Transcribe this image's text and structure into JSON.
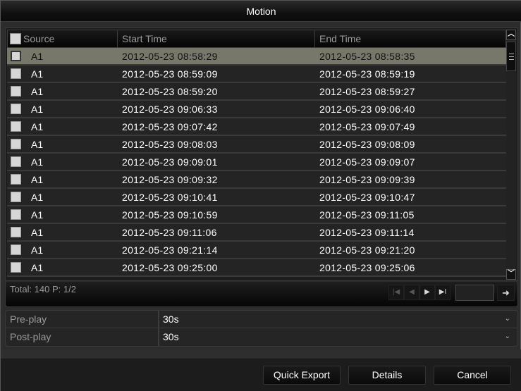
{
  "window": {
    "title": "Motion"
  },
  "table": {
    "columns": {
      "source": "Source",
      "start": "Start Time",
      "end": "End Time"
    },
    "rows": [
      {
        "source": "A1",
        "start": "2012-05-23 08:58:29",
        "end": "2012-05-23 08:58:35",
        "selected": true
      },
      {
        "source": "A1",
        "start": "2012-05-23 08:59:09",
        "end": "2012-05-23 08:59:19"
      },
      {
        "source": "A1",
        "start": "2012-05-23 08:59:20",
        "end": "2012-05-23 08:59:27"
      },
      {
        "source": "A1",
        "start": "2012-05-23 09:06:33",
        "end": "2012-05-23 09:06:40"
      },
      {
        "source": "A1",
        "start": "2012-05-23 09:07:42",
        "end": "2012-05-23 09:07:49"
      },
      {
        "source": "A1",
        "start": "2012-05-23 09:08:03",
        "end": "2012-05-23 09:08:09"
      },
      {
        "source": "A1",
        "start": "2012-05-23 09:09:01",
        "end": "2012-05-23 09:09:07"
      },
      {
        "source": "A1",
        "start": "2012-05-23 09:09:32",
        "end": "2012-05-23 09:09:39"
      },
      {
        "source": "A1",
        "start": "2012-05-23 09:10:41",
        "end": "2012-05-23 09:10:47"
      },
      {
        "source": "A1",
        "start": "2012-05-23 09:10:59",
        "end": "2012-05-23 09:11:05"
      },
      {
        "source": "A1",
        "start": "2012-05-23 09:11:06",
        "end": "2012-05-23 09:11:14"
      },
      {
        "source": "A1",
        "start": "2012-05-23 09:21:14",
        "end": "2012-05-23 09:21:20"
      },
      {
        "source": "A1",
        "start": "2012-05-23 09:25:00",
        "end": "2012-05-23 09:25:06"
      }
    ],
    "scroll_up_icon": "chevron-up-icon",
    "scroll_down_icon": "chevron-down-icon"
  },
  "pager": {
    "total_text": "Total: 140  P: 1/2",
    "first_icon": "⏮",
    "prev_icon": "◀",
    "next_icon": "▶",
    "last_icon": "▶I",
    "page_input_value": "",
    "go_icon": "➜"
  },
  "settings": [
    {
      "label": "Pre-play",
      "value": "30s"
    },
    {
      "label": "Post-play",
      "value": "30s"
    }
  ],
  "footer": {
    "quick_export": "Quick Export",
    "details": "Details",
    "cancel": "Cancel"
  },
  "colors": {
    "selected_row": "#77776a",
    "background": "#2c2c2c"
  }
}
